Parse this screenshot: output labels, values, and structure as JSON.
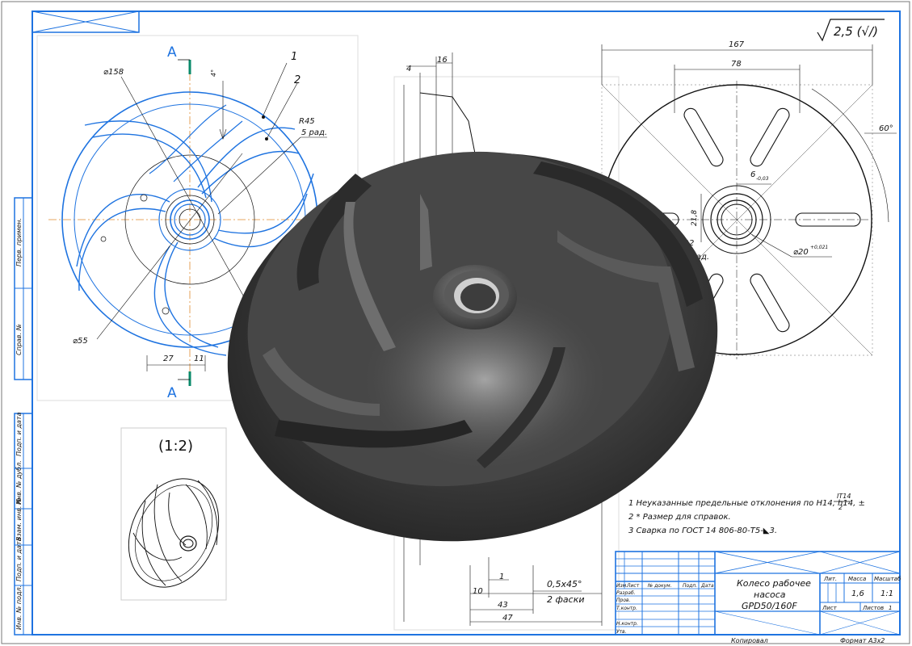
{
  "roughness": {
    "value": "2,5 (√/)"
  },
  "section_marks": {
    "top": "A",
    "bottom": "A"
  },
  "front_view": {
    "dims": {
      "d158": "⌀158",
      "r45": "R45",
      "five_rad": "5 рад.",
      "d55": "⌀55",
      "d27": "27",
      "d11": "11",
      "callout1": "1",
      "callout2": "2",
      "a_angle": "4°"
    }
  },
  "section_view": {
    "dims": {
      "d4": "4",
      "d16": "16",
      "d1": "1",
      "d10": "10",
      "d43": "43",
      "d47": "47",
      "chamfer": "0,5x45°",
      "chamfer_note": "2 фаски"
    }
  },
  "side_view": {
    "dims": {
      "d167": "167",
      "d78": "78",
      "angle60": "60°",
      "key6": "6",
      "key6_tol": "-0,03",
      "d218": "21,8",
      "r2": "R2",
      "four_rad": "4 рад.",
      "d20": "⌀20",
      "d20_tol": "+0,021"
    }
  },
  "scale_view": {
    "label": "(1:2)"
  },
  "notes": [
    "1 Неуказанные предельные отклонения по H14, h14, ±",
    "2 * Размер для справок.",
    "3 Сварка по ГОСТ 14 806-80-Т5-◣3."
  ],
  "notes_fraction": {
    "num": "IT14",
    "den": "2"
  },
  "left_strip": [
    "Перв. примен.",
    "Справ. №",
    "Подп. и дата",
    "Инв. № дубл.",
    "Взам. инв. №",
    "Подп. и дата",
    "Инв. № подл."
  ],
  "title_block": {
    "part_name_1": "Колесо рабочее",
    "part_name_2": "насоса",
    "part_name_3": "GPD50/160F",
    "col_headers": [
      "Изм.",
      "Лист",
      "№ докум.",
      "Подп.",
      "Дата"
    ],
    "row_labels": [
      "Разраб.",
      "Пров.",
      "Т.контр.",
      "Н.контр.",
      "Утв."
    ],
    "lit": "Лит.",
    "mass": "Масса",
    "scale": "Масштаб",
    "mass_value": "1,6",
    "scale_value": "1:1",
    "sheet": "Лист",
    "sheets": "Листов",
    "sheets_value": "1",
    "copied": "Копировал",
    "format": "Формат",
    "format_value": "А3x2"
  }
}
